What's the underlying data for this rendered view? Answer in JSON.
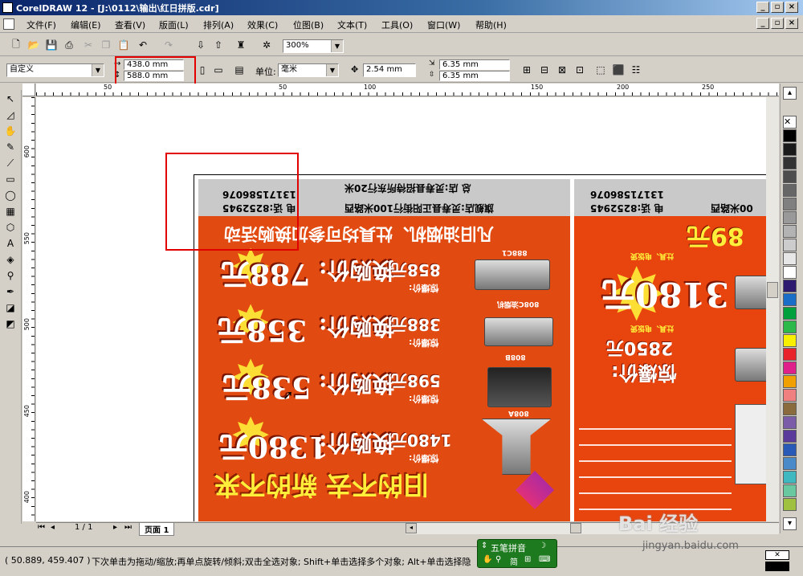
{
  "window": {
    "title": "CorelDRAW 12 - [J:\\0112\\输出\\红日拼版.cdr]"
  },
  "menu": [
    "文件(F)",
    "编辑(E)",
    "查看(V)",
    "版面(L)",
    "排列(A)",
    "效果(C)",
    "位图(B)",
    "文本(T)",
    "工具(O)",
    "窗口(W)",
    "帮助(H)"
  ],
  "toolbar": {
    "zoom": "300%"
  },
  "propbar": {
    "page_size": "自定义",
    "width": "438.0 mm",
    "height": "588.0 mm",
    "unit_label": "单位:",
    "unit": "毫米",
    "nudge": "2.54 mm",
    "dup_x": "6.35 mm",
    "dup_y": "6.35 mm"
  },
  "ruler": {
    "h_labels": [
      "50",
      "50",
      "100",
      "150",
      "200",
      "250"
    ],
    "v_labels": [
      "600",
      "550",
      "500",
      "450",
      "400"
    ],
    "unit": "毫米"
  },
  "page_nav": {
    "counter": "1 / 1",
    "tab": "页面 1"
  },
  "status": {
    "coords": "( 50.889, 459.407 )",
    "hint": "下次单击为拖动/缩放;再单点旋转/倾斜;双击全选对象; Shift+单击选择多个对象; Alt+单击选择隐"
  },
  "ime": {
    "name": "五笔拼音",
    "row2": "简"
  },
  "watermark": {
    "line1": "Bai 经验",
    "line2": "jingyan.baidu.com"
  },
  "flyer_left": {
    "phone": "13171586076",
    "tel": "电  话:8252945",
    "store1": "旗舰店:灵寿县正阳街行100米路西",
    "store2": "总  店:灵寿县招待所东行20米",
    "headline": "凡旧油烟机、灶具均可参加换购活动",
    "items": [
      {
        "model": "888C1",
        "old_label": "惊爆价:",
        "old": "858元",
        "new_label": "换购价:",
        "new": "788元"
      },
      {
        "model": "808C油烟机",
        "old_label": "惊爆价:",
        "old": "388元",
        "new_label": "换购价:",
        "new": "358元"
      },
      {
        "model": "808B",
        "old_label": "惊爆价:",
        "old": "598元",
        "new_label": "换购价:",
        "new": "538元"
      },
      {
        "model": "808A",
        "old_label": "惊爆价:",
        "old": "1480元",
        "new_label": "换购价:",
        "new": "1380元"
      }
    ],
    "slogan": "旧的不去 新的不来"
  },
  "flyer_right": {
    "phone": "13171586076",
    "tel": "电  话:8252945",
    "addr": "00米路西",
    "price_top": "89元",
    "big": "3180元",
    "lbl": "惊爆价:",
    "price2": "2850元",
    "note1": "灶具、电饭煲",
    "note2": "灶具、电饭煲"
  },
  "colors": {
    "accent_red": "#e00000",
    "flyer_bg": "#e14a10",
    "price_yellow": "#ffef3a"
  }
}
